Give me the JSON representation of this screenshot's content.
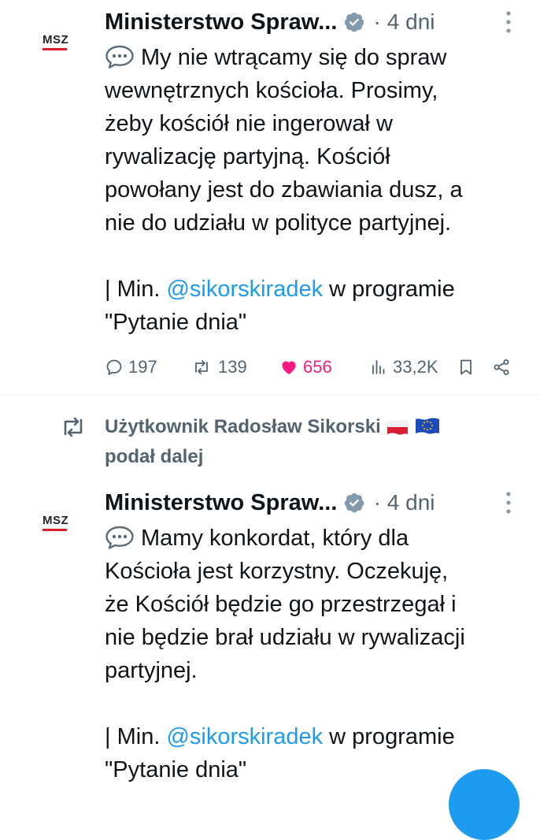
{
  "tweets": [
    {
      "avatar_text": "MSZ",
      "author": "Ministerstwo Spraw...",
      "separator": "·",
      "time": "4 dni",
      "lines": [
        "My nie wtrącamy się do spraw",
        "wewnętrznych kościoła. Prosimy,",
        "żeby kościół nie ingerował w",
        "rywalizację partyjną. Kościół",
        "powołany jest do zbawiania dusz, a",
        "nie do udziału w polityce partyjnej."
      ],
      "signature_prefix": "| Min. ",
      "mention": "@sikorskiradek",
      "signature_suffix": " w programie",
      "signature_line2": "\"Pytanie dnia\"",
      "replies": "197",
      "reposts": "139",
      "likes": "656",
      "views": "33,2K"
    },
    {
      "avatar_text": "MSZ",
      "author": "Ministerstwo Spraw...",
      "separator": "·",
      "time": "4 dni",
      "lines": [
        "Mamy konkordat, który dla",
        "Kościoła jest korzystny. Oczekuję,",
        "że Kościół będzie go przestrzegał i",
        "nie będzie brał udziału w rywalizacji",
        "partyjnej."
      ],
      "signature_prefix": "| Min. ",
      "mention": "@sikorskiradek",
      "signature_suffix": " w programie",
      "signature_line2": "\"Pytanie dnia\""
    }
  ],
  "repost_note": {
    "line1": "Użytkownik Radosław Sikorski",
    "line2": "podał dalej"
  },
  "colors": {
    "accent": "#1d9bf0",
    "like": "#f91880",
    "muted": "#536471",
    "text": "#0f1419",
    "msz_red": "#d8202a"
  },
  "icons": {
    "verified": "verified-badge-icon",
    "more": "more-vertical-icon",
    "speech": "speech-balloon-icon",
    "reply": "reply-icon",
    "repost": "repost-icon",
    "like": "heart-icon",
    "views": "views-icon",
    "bookmark": "bookmark-icon",
    "share": "share-icon",
    "flags": [
      "poland-flag-icon",
      "eu-flag-icon"
    ]
  }
}
